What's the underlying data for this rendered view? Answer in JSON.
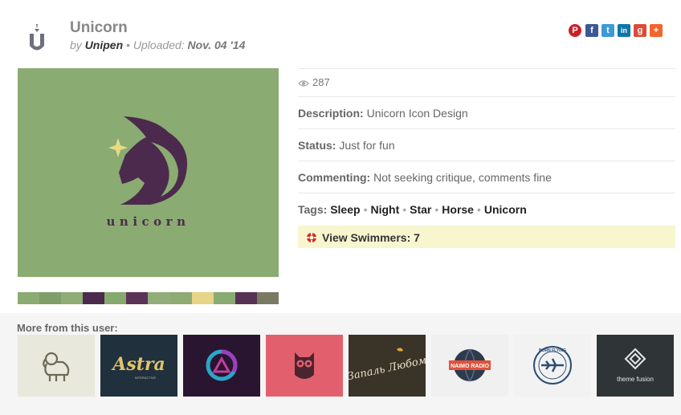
{
  "header": {
    "title": "Unicorn",
    "by_prefix": "by",
    "author": "Unipen",
    "bullet": "•",
    "uploaded_label": "Uploaded:",
    "date": "Nov. 04 '14"
  },
  "share": [
    {
      "name": "pinterest",
      "glyph": "P",
      "color": "#cb2027"
    },
    {
      "name": "facebook",
      "glyph": "f",
      "color": "#3b5998"
    },
    {
      "name": "twitter",
      "glyph": "t",
      "color": "#3d9bd4"
    },
    {
      "name": "linkedin",
      "glyph": "in",
      "color": "#0e76a8"
    },
    {
      "name": "google-plus",
      "glyph": "g",
      "color": "#dd4b39"
    },
    {
      "name": "more",
      "glyph": "+",
      "color": "#f2662d"
    }
  ],
  "hero": {
    "wordmark": "unicorn",
    "background": "#8aab71",
    "mark_color": "#4c2a4d",
    "star_color": "#e8d985"
  },
  "palette": [
    "#8aab71",
    "#7f9e68",
    "#8fad75",
    "#4c2a4d",
    "#88a96e",
    "#5a3456",
    "#93ad7a",
    "#8faa73",
    "#e6d487",
    "#8aab71",
    "#563355",
    "#7a7a62"
  ],
  "meta": {
    "views": "287",
    "description_label": "Description:",
    "description": "Unicorn Icon Design",
    "status_label": "Status:",
    "status": "Just for fun",
    "commenting_label": "Commenting:",
    "commenting": "Not seeking critique, comments fine",
    "tags_label": "Tags:",
    "tags": [
      "Sleep",
      "Night",
      "Star",
      "Horse",
      "Unicorn"
    ],
    "tag_separator": "•",
    "swimmers_label": "View Swimmers: 7"
  },
  "more": {
    "title": "More from this user:",
    "thumbs": [
      {
        "name": "elephant",
        "bg": "#e9e8dc",
        "text": ""
      },
      {
        "name": "astra",
        "bg": "#20303c",
        "text": "Astra",
        "subtext": "INTERACTIVE"
      },
      {
        "name": "triangle-circle",
        "bg": "#2a1530",
        "text": ""
      },
      {
        "name": "owl",
        "bg": "#e2606d",
        "text": ""
      },
      {
        "name": "zapal-lyubom",
        "bg": "#3a3328",
        "text": "Запаль Любом"
      },
      {
        "name": "naimo-radio",
        "bg": "#f0f0f0",
        "text": "NAIMO RADIO"
      },
      {
        "name": "born-flying",
        "bg": "#f2f2f2",
        "text": "BORN FLYING"
      },
      {
        "name": "theme-fusion",
        "bg": "#2f3436",
        "text": "theme fusion"
      }
    ]
  }
}
